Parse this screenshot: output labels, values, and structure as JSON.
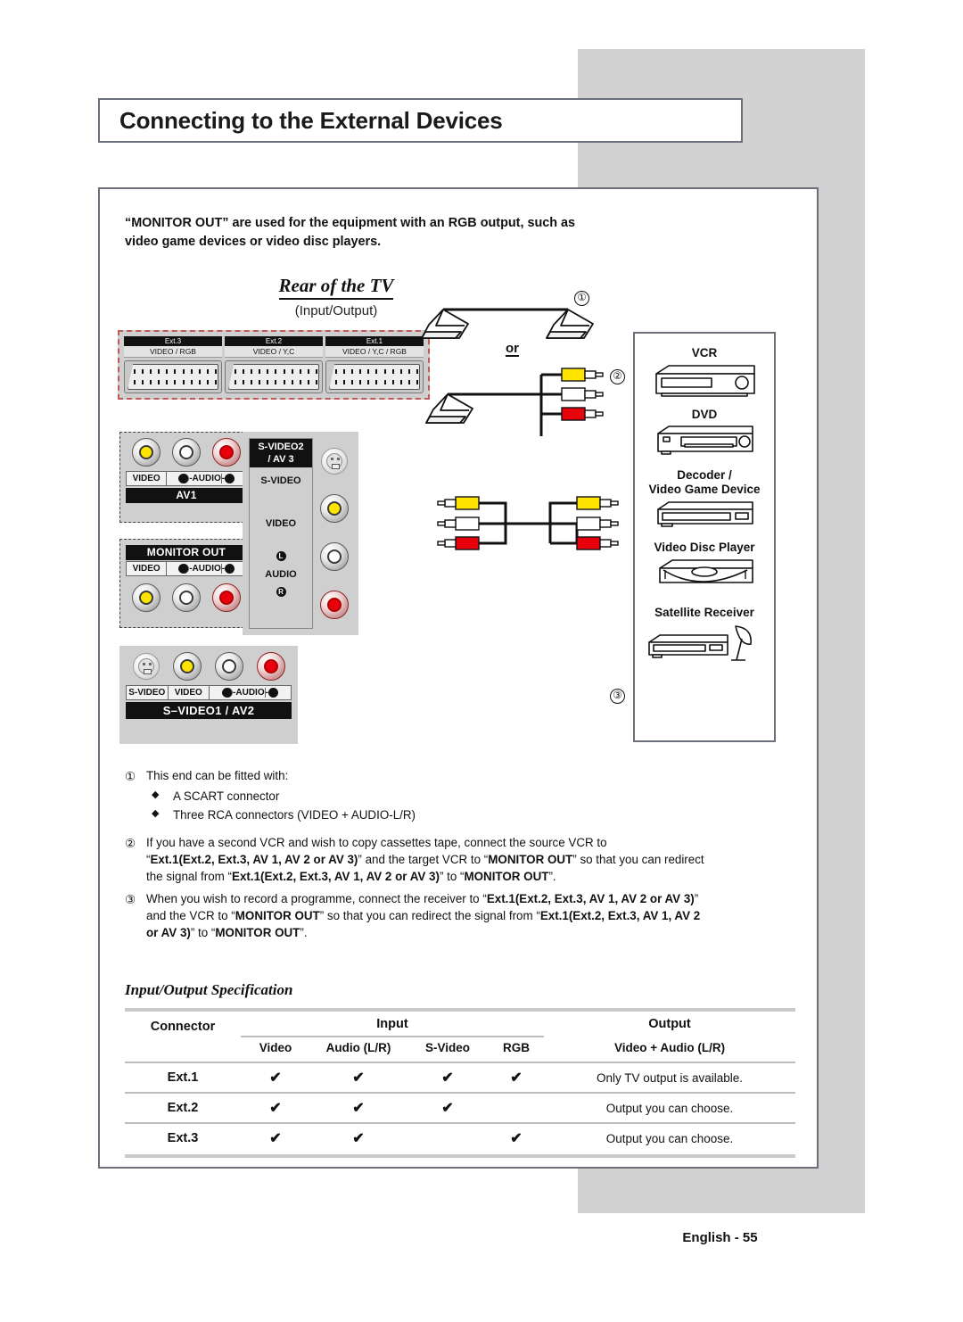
{
  "page": {
    "title": "Connecting to the External Devices",
    "footer": "English - 55"
  },
  "intro": {
    "line1": "“MONITOR OUT” are used for the equipment with an RGB output, such as",
    "line2": "video game devices or video disc players."
  },
  "diagram": {
    "rear_title": "Rear of the TV",
    "rear_sub": "(Input/Output)",
    "marker_1": "①",
    "marker_2": "②",
    "marker_3": "③",
    "or_label": "or",
    "scart": [
      {
        "name": "Ext.3",
        "signals": "VIDEO / RGB"
      },
      {
        "name": "Ext.2",
        "signals": "VIDEO / Y,C"
      },
      {
        "name": "Ext.1",
        "signals": "VIDEO / Y,C / RGB"
      }
    ],
    "av1": {
      "video": "VIDEO",
      "audio_l": "L",
      "audio": "AUDIO",
      "audio_r": "R",
      "title": "AV1"
    },
    "monitor_out": {
      "title": "MONITOR OUT",
      "video": "VIDEO",
      "audio_l": "L",
      "audio": "AUDIO",
      "audio_r": "R"
    },
    "svideo1": {
      "svideo": "S-VIDEO",
      "video": "VIDEO",
      "audio_l": "L",
      "audio": "AUDIO",
      "audio_r": "R",
      "title": "S–VIDEO1 / AV2"
    },
    "svideo2": {
      "title_l1": "S-VIDEO2",
      "title_l2": "/ AV 3",
      "svideo": "S-VIDEO",
      "video": "VIDEO",
      "audio_l": "L",
      "audio": "AUDIO",
      "audio_r": "R"
    },
    "devices": [
      {
        "label": "VCR"
      },
      {
        "label": "DVD"
      },
      {
        "label": "Decoder /\nVideo Game Device"
      },
      {
        "label": "Video Disc Player"
      },
      {
        "label": "Satellite Receiver"
      }
    ]
  },
  "notes": {
    "n1": {
      "marker": "①",
      "text": "This end can be fitted with:",
      "bullets": [
        "A SCART connector",
        "Three RCA connectors (VIDEO + AUDIO-L/R)"
      ]
    },
    "n2": {
      "marker": "②",
      "p1": "If you have a second VCR and wish to copy cassettes tape, connect the source VCR to",
      "p2a": "“",
      "p2b": "Ext.1(Ext.2, Ext.3, AV 1, AV 2 or AV 3)",
      "p2c": "” and the target VCR to “",
      "p2d": "MONITOR OUT",
      "p2e": "” so that you can redirect",
      "p3a": "the signal from  “",
      "p3b": "Ext.1(Ext.2, Ext.3, AV 1, AV 2 or AV 3)",
      "p3c": "” to “",
      "p3d": "MONITOR OUT",
      "p3e": "”."
    },
    "n3": {
      "marker": "③",
      "p1a": "When you wish to record a programme, connect the receiver to “",
      "p1b": "Ext.1(Ext.2, Ext.3, AV 1, AV 2 or AV 3)",
      "p1c": "”",
      "p2a": "and the VCR to “",
      "p2b": "MONITOR OUT",
      "p2c": "” so that you can redirect the signal from “",
      "p2d": "Ext.1(Ext.2, Ext.3, AV 1, AV 2",
      "p3a": "or AV 3)",
      "p3b": "” to “",
      "p3c": "MONITOR OUT",
      "p3d": "”."
    }
  },
  "spec_table": {
    "title": "Input/Output Specification",
    "group_connector": "Connector",
    "group_input": "Input",
    "group_output": "Output",
    "sub_headers": [
      "Video",
      "Audio (L/R)",
      "S-Video",
      "RGB"
    ],
    "output_header": "Video + Audio (L/R)",
    "check": "✔",
    "rows": [
      {
        "connector": "Ext.1",
        "video": true,
        "audio": true,
        "svideo": true,
        "rgb": true,
        "output": "Only TV output is available."
      },
      {
        "connector": "Ext.2",
        "video": true,
        "audio": true,
        "svideo": true,
        "rgb": false,
        "output": "Output you can choose."
      },
      {
        "connector": "Ext.3",
        "video": true,
        "audio": true,
        "svideo": false,
        "rgb": true,
        "output": "Output you can choose."
      }
    ]
  },
  "colors": {
    "grey_panel": "#d2d2d2",
    "frame": "#6b6f7a",
    "yellow": "#ffe400",
    "red": "#e8000d",
    "white": "#ffffff",
    "scart_dash": "#c05a5a"
  }
}
